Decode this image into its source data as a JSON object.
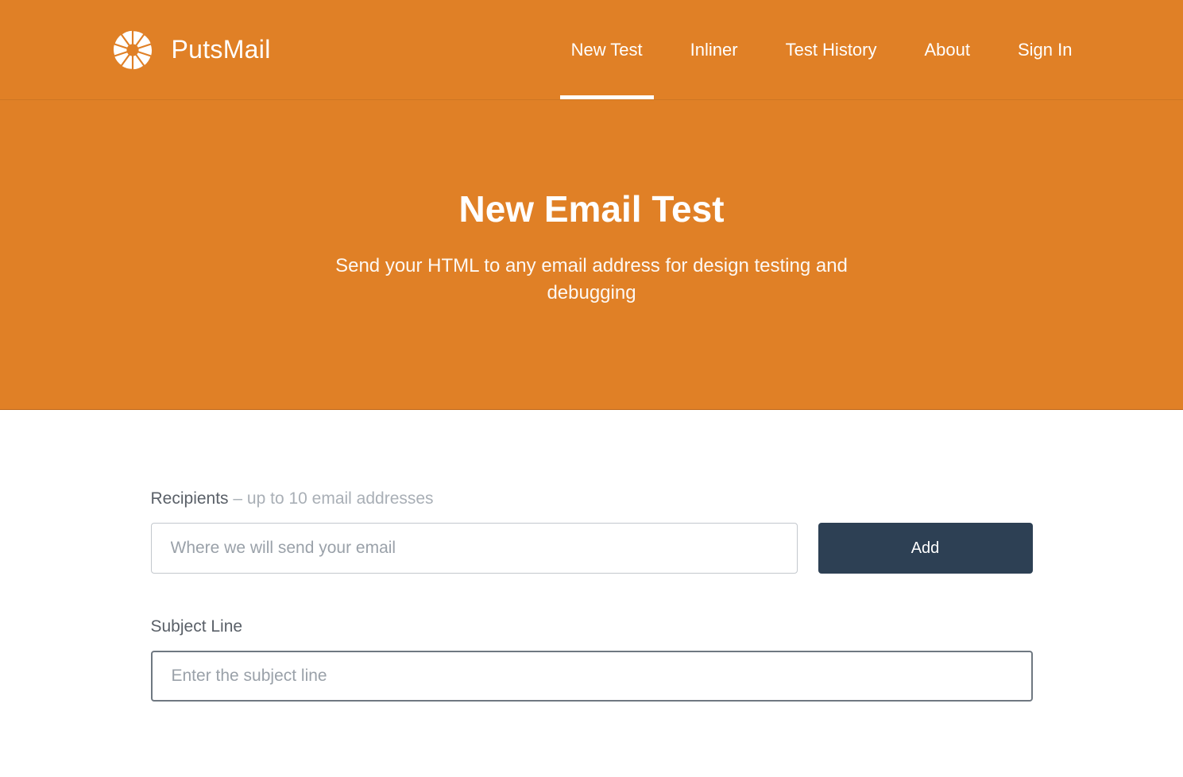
{
  "brand": {
    "name": "PutsMail"
  },
  "nav": {
    "items": [
      {
        "label": "New Test",
        "active": true
      },
      {
        "label": "Inliner",
        "active": false
      },
      {
        "label": "Test History",
        "active": false
      },
      {
        "label": "About",
        "active": false
      },
      {
        "label": "Sign In",
        "active": false
      }
    ]
  },
  "hero": {
    "title": "New Email Test",
    "subtitle": "Send your HTML to any email address for design testing and debugging"
  },
  "form": {
    "recipients": {
      "label": "Recipients",
      "hint": " – up to 10 email addresses",
      "placeholder": "Where we will send your email",
      "add_button": "Add"
    },
    "subject": {
      "label": "Subject Line",
      "placeholder": "Enter the subject line"
    }
  }
}
